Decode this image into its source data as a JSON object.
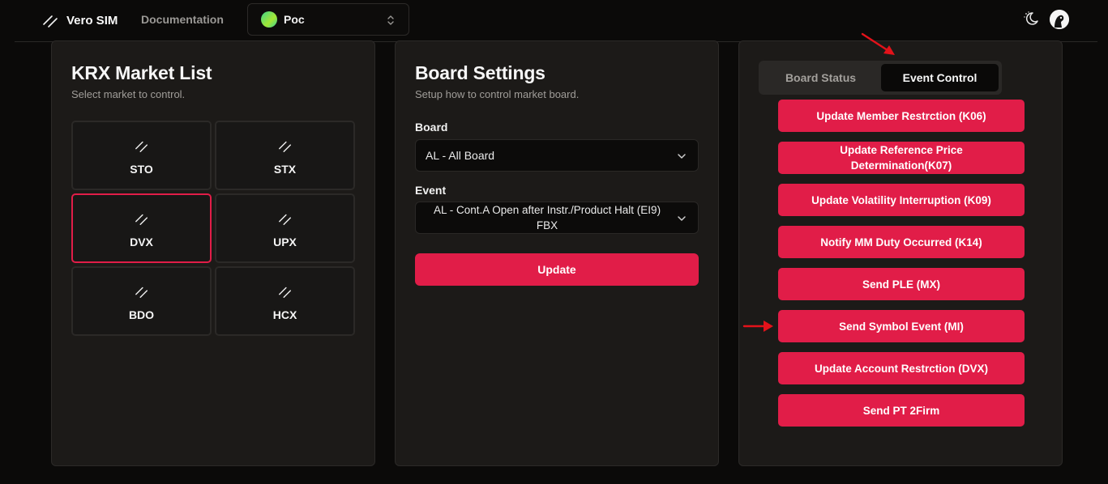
{
  "header": {
    "brand_icon": "slash-logo-icon",
    "app_name": "Vero SIM",
    "documentation_link": "Documentation",
    "project": {
      "name": "Poc",
      "icon": "gradient-avatar-dot"
    },
    "theme_icon": "moon-sun-toggle-icon",
    "avatar_icon": "user-avatar-icon"
  },
  "market_list": {
    "title": "KRX Market List",
    "subtitle": "Select market to control.",
    "selected": "DVX",
    "markets": [
      {
        "label": "STO",
        "icon": "slash-logo-icon"
      },
      {
        "label": "STX",
        "icon": "slash-logo-icon"
      },
      {
        "label": "DVX",
        "icon": "slash-logo-icon"
      },
      {
        "label": "UPX",
        "icon": "slash-logo-icon"
      },
      {
        "label": "BDO",
        "icon": "slash-logo-icon"
      },
      {
        "label": "HCX",
        "icon": "slash-logo-icon"
      }
    ]
  },
  "board_settings": {
    "title": "Board Settings",
    "subtitle": "Setup how to control market board.",
    "board_label": "Board",
    "board_value": "AL - All Board",
    "event_label": "Event",
    "event_value": "AL - Cont.A Open after Instr./Product Halt (EI9) FBX",
    "update_button": "Update"
  },
  "event_panel": {
    "tabs": [
      {
        "label": "Board Status",
        "active": false
      },
      {
        "label": "Event Control",
        "active": true
      }
    ],
    "buttons": [
      "Update Member Restrction (K06)",
      "Update Reference Price Determination(K07)",
      "Update Volatility Interruption (K09)",
      "Notify MM Duty Occurred (K14)",
      "Send PLE (MX)",
      "Send Symbol Event (MI)",
      "Update Account Restrction (DVX)",
      "Send PT 2Firm"
    ]
  },
  "colors": {
    "accent": "#e11d48",
    "background": "#0b0a09",
    "panel": "#1c1a18",
    "annotation_arrow": "#e3121a"
  }
}
